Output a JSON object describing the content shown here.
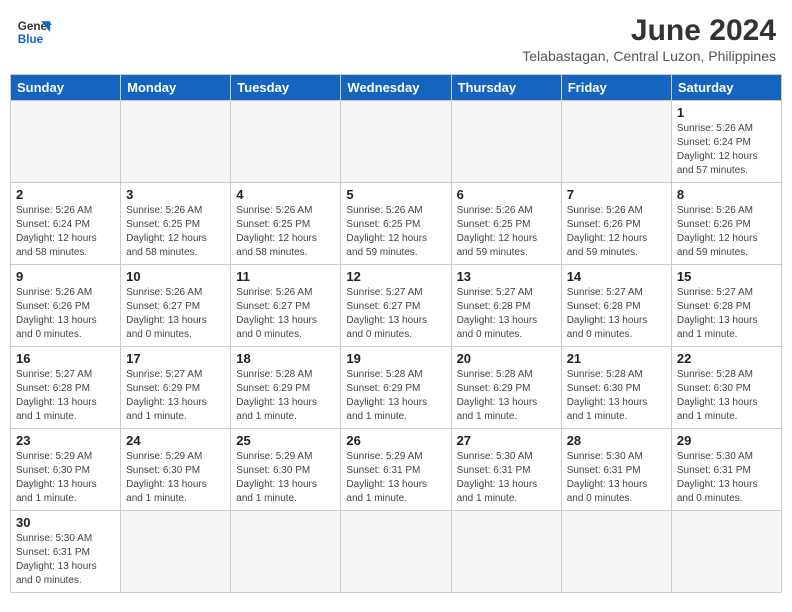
{
  "header": {
    "logo_general": "General",
    "logo_blue": "Blue",
    "month_year": "June 2024",
    "location": "Telabastagan, Central Luzon, Philippines"
  },
  "days_of_week": [
    "Sunday",
    "Monday",
    "Tuesday",
    "Wednesday",
    "Thursday",
    "Friday",
    "Saturday"
  ],
  "weeks": [
    [
      {
        "day": null,
        "info": null
      },
      {
        "day": null,
        "info": null
      },
      {
        "day": null,
        "info": null
      },
      {
        "day": null,
        "info": null
      },
      {
        "day": null,
        "info": null
      },
      {
        "day": null,
        "info": null
      },
      {
        "day": "1",
        "info": "Sunrise: 5:26 AM\nSunset: 6:24 PM\nDaylight: 12 hours\nand 57 minutes."
      }
    ],
    [
      {
        "day": "2",
        "info": "Sunrise: 5:26 AM\nSunset: 6:24 PM\nDaylight: 12 hours\nand 58 minutes."
      },
      {
        "day": "3",
        "info": "Sunrise: 5:26 AM\nSunset: 6:25 PM\nDaylight: 12 hours\nand 58 minutes."
      },
      {
        "day": "4",
        "info": "Sunrise: 5:26 AM\nSunset: 6:25 PM\nDaylight: 12 hours\nand 58 minutes."
      },
      {
        "day": "5",
        "info": "Sunrise: 5:26 AM\nSunset: 6:25 PM\nDaylight: 12 hours\nand 59 minutes."
      },
      {
        "day": "6",
        "info": "Sunrise: 5:26 AM\nSunset: 6:25 PM\nDaylight: 12 hours\nand 59 minutes."
      },
      {
        "day": "7",
        "info": "Sunrise: 5:26 AM\nSunset: 6:26 PM\nDaylight: 12 hours\nand 59 minutes."
      },
      {
        "day": "8",
        "info": "Sunrise: 5:26 AM\nSunset: 6:26 PM\nDaylight: 12 hours\nand 59 minutes."
      }
    ],
    [
      {
        "day": "9",
        "info": "Sunrise: 5:26 AM\nSunset: 6:26 PM\nDaylight: 13 hours\nand 0 minutes."
      },
      {
        "day": "10",
        "info": "Sunrise: 5:26 AM\nSunset: 6:27 PM\nDaylight: 13 hours\nand 0 minutes."
      },
      {
        "day": "11",
        "info": "Sunrise: 5:26 AM\nSunset: 6:27 PM\nDaylight: 13 hours\nand 0 minutes."
      },
      {
        "day": "12",
        "info": "Sunrise: 5:27 AM\nSunset: 6:27 PM\nDaylight: 13 hours\nand 0 minutes."
      },
      {
        "day": "13",
        "info": "Sunrise: 5:27 AM\nSunset: 6:28 PM\nDaylight: 13 hours\nand 0 minutes."
      },
      {
        "day": "14",
        "info": "Sunrise: 5:27 AM\nSunset: 6:28 PM\nDaylight: 13 hours\nand 0 minutes."
      },
      {
        "day": "15",
        "info": "Sunrise: 5:27 AM\nSunset: 6:28 PM\nDaylight: 13 hours\nand 1 minute."
      }
    ],
    [
      {
        "day": "16",
        "info": "Sunrise: 5:27 AM\nSunset: 6:28 PM\nDaylight: 13 hours\nand 1 minute."
      },
      {
        "day": "17",
        "info": "Sunrise: 5:27 AM\nSunset: 6:29 PM\nDaylight: 13 hours\nand 1 minute."
      },
      {
        "day": "18",
        "info": "Sunrise: 5:28 AM\nSunset: 6:29 PM\nDaylight: 13 hours\nand 1 minute."
      },
      {
        "day": "19",
        "info": "Sunrise: 5:28 AM\nSunset: 6:29 PM\nDaylight: 13 hours\nand 1 minute."
      },
      {
        "day": "20",
        "info": "Sunrise: 5:28 AM\nSunset: 6:29 PM\nDaylight: 13 hours\nand 1 minute."
      },
      {
        "day": "21",
        "info": "Sunrise: 5:28 AM\nSunset: 6:30 PM\nDaylight: 13 hours\nand 1 minute."
      },
      {
        "day": "22",
        "info": "Sunrise: 5:28 AM\nSunset: 6:30 PM\nDaylight: 13 hours\nand 1 minute."
      }
    ],
    [
      {
        "day": "23",
        "info": "Sunrise: 5:29 AM\nSunset: 6:30 PM\nDaylight: 13 hours\nand 1 minute."
      },
      {
        "day": "24",
        "info": "Sunrise: 5:29 AM\nSunset: 6:30 PM\nDaylight: 13 hours\nand 1 minute."
      },
      {
        "day": "25",
        "info": "Sunrise: 5:29 AM\nSunset: 6:30 PM\nDaylight: 13 hours\nand 1 minute."
      },
      {
        "day": "26",
        "info": "Sunrise: 5:29 AM\nSunset: 6:31 PM\nDaylight: 13 hours\nand 1 minute."
      },
      {
        "day": "27",
        "info": "Sunrise: 5:30 AM\nSunset: 6:31 PM\nDaylight: 13 hours\nand 1 minute."
      },
      {
        "day": "28",
        "info": "Sunrise: 5:30 AM\nSunset: 6:31 PM\nDaylight: 13 hours\nand 0 minutes."
      },
      {
        "day": "29",
        "info": "Sunrise: 5:30 AM\nSunset: 6:31 PM\nDaylight: 13 hours\nand 0 minutes."
      }
    ],
    [
      {
        "day": "30",
        "info": "Sunrise: 5:30 AM\nSunset: 6:31 PM\nDaylight: 13 hours\nand 0 minutes."
      },
      {
        "day": null,
        "info": null
      },
      {
        "day": null,
        "info": null
      },
      {
        "day": null,
        "info": null
      },
      {
        "day": null,
        "info": null
      },
      {
        "day": null,
        "info": null
      },
      {
        "day": null,
        "info": null
      }
    ]
  ]
}
